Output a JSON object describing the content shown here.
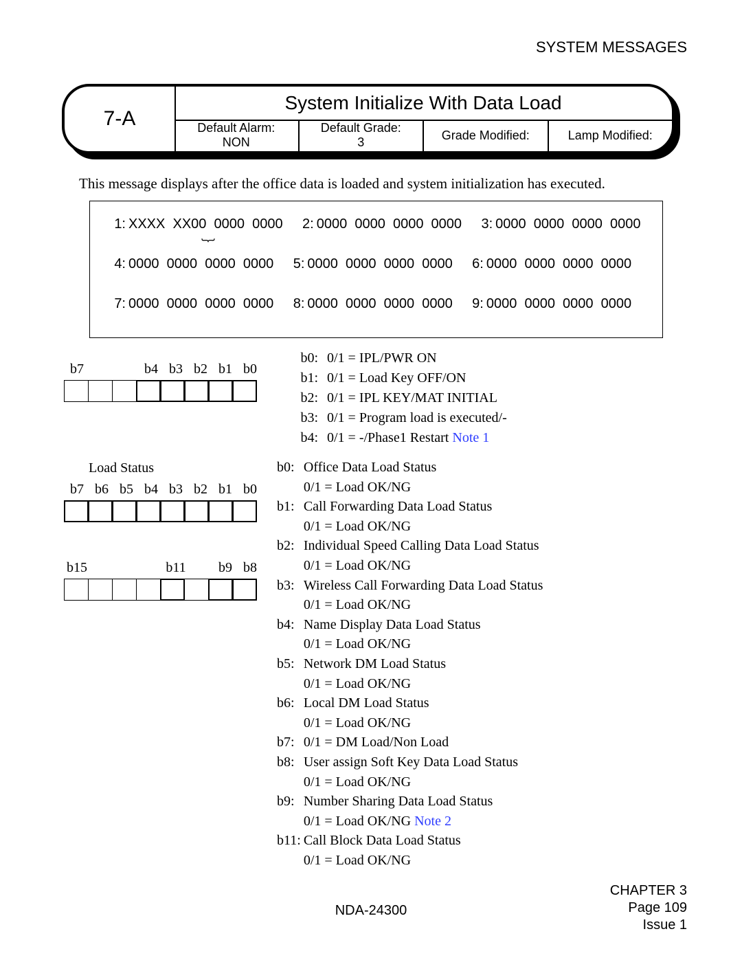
{
  "running_head": "SYSTEM MESSAGES",
  "header": {
    "code": "7-A",
    "title": "System Initialize With Data Load",
    "cells": [
      {
        "label": "Default Alarm:",
        "value": "NON"
      },
      {
        "label": "Default Grade:",
        "value": "3"
      },
      {
        "label": "Grade Modified:",
        "value": ""
      },
      {
        "label": "Lamp Modified:",
        "value": ""
      }
    ]
  },
  "intro": "This message displays after the office data is loaded and system initialization has executed.",
  "data_rows": [
    [
      {
        "n": "1:",
        "v": "XXXX  XX00  0000  0000"
      },
      {
        "n": "2:",
        "v": "0000  0000  0000  0000"
      },
      {
        "n": "3:",
        "v": "0000  0000  0000  0000"
      }
    ],
    [
      {
        "n": "4:",
        "v": "0000  0000  0000  0000"
      },
      {
        "n": "5:",
        "v": "0000  0000  0000  0000"
      },
      {
        "n": "6:",
        "v": "0000  0000  0000  0000"
      }
    ],
    [
      {
        "n": "7:",
        "v": "0000  0000  0000  0000"
      },
      {
        "n": "8:",
        "v": "0000  0000  0000  0000"
      },
      {
        "n": "9:",
        "v": "0000  0000  0000  0000"
      }
    ]
  ],
  "bitset1": {
    "headers": [
      "b7",
      "",
      "",
      "b4",
      "b3",
      "b2",
      "b1",
      "b0"
    ],
    "bold": [
      false,
      false,
      false,
      true,
      true,
      true,
      true,
      true
    ]
  },
  "desc1": [
    {
      "k": "b0:",
      "v": "0/1 = IPL/PWR ON"
    },
    {
      "k": "b1:",
      "v": "0/1 = Load Key OFF/ON"
    },
    {
      "k": "b2:",
      "v": "0/1 = IPL KEY/MAT INITIAL"
    },
    {
      "k": "b3:",
      "v": "0/1 = Program load is executed/-"
    },
    {
      "k": "b4:",
      "v": "0/1 = -/Phase1 Restart ",
      "note": "Note 1"
    }
  ],
  "bitset2": {
    "title": "Load  Status",
    "headers_a": [
      "b7",
      "b6",
      "b5",
      "b4",
      "b3",
      "b2",
      "b1",
      "b0"
    ],
    "bold_a": [
      true,
      true,
      true,
      true,
      true,
      true,
      true,
      true
    ],
    "headers_b": [
      "b15",
      "",
      "",
      "",
      "b11",
      "",
      "b9",
      "b8"
    ],
    "bold_b": [
      false,
      false,
      false,
      false,
      true,
      false,
      true,
      true
    ]
  },
  "desc2": [
    {
      "k": "b0:",
      "v": "Office Data Load Status"
    },
    {
      "k": "",
      "v": "0/1 = Load OK/NG"
    },
    {
      "k": "b1:",
      "v": "Call Forwarding Data Load Status"
    },
    {
      "k": "",
      "v": "0/1 = Load OK/NG"
    },
    {
      "k": "b2:",
      "v": "Individual Speed Calling Data Load Status"
    },
    {
      "k": "",
      "v": "0/1 = Load OK/NG"
    },
    {
      "k": "b3:",
      "v": "Wireless Call Forwarding Data Load Status"
    },
    {
      "k": "",
      "v": "0/1 = Load OK/NG"
    },
    {
      "k": "b4:",
      "v": "Name Display Data Load Status"
    },
    {
      "k": "",
      "v": "0/1 = Load OK/NG"
    },
    {
      "k": "b5:",
      "v": "Network DM Load Status"
    },
    {
      "k": "",
      "v": "0/1 = Load OK/NG"
    },
    {
      "k": "b6:",
      "v": "Local DM Load Status"
    },
    {
      "k": "",
      "v": "0/1 = Load OK/NG"
    },
    {
      "k": "b7:",
      "v": "0/1 = DM Load/Non Load"
    },
    {
      "k": "b8:",
      "v": "User assign Soft Key Data Load Status"
    },
    {
      "k": "",
      "v": "0/1 = Load OK/NG"
    },
    {
      "k": "b9:",
      "v": "Number Sharing Data Load Status"
    },
    {
      "k": "",
      "v": "0/1 = Load OK/NG ",
      "note": "Note 2"
    },
    {
      "k": "b11:",
      "v": "Call Block Data Load Status"
    },
    {
      "k": "",
      "v": "0/1 = Load OK/NG"
    }
  ],
  "footer": {
    "doc": "NDA-24300",
    "chapter": "CHAPTER 3",
    "page": "Page 109",
    "issue": "Issue 1"
  }
}
